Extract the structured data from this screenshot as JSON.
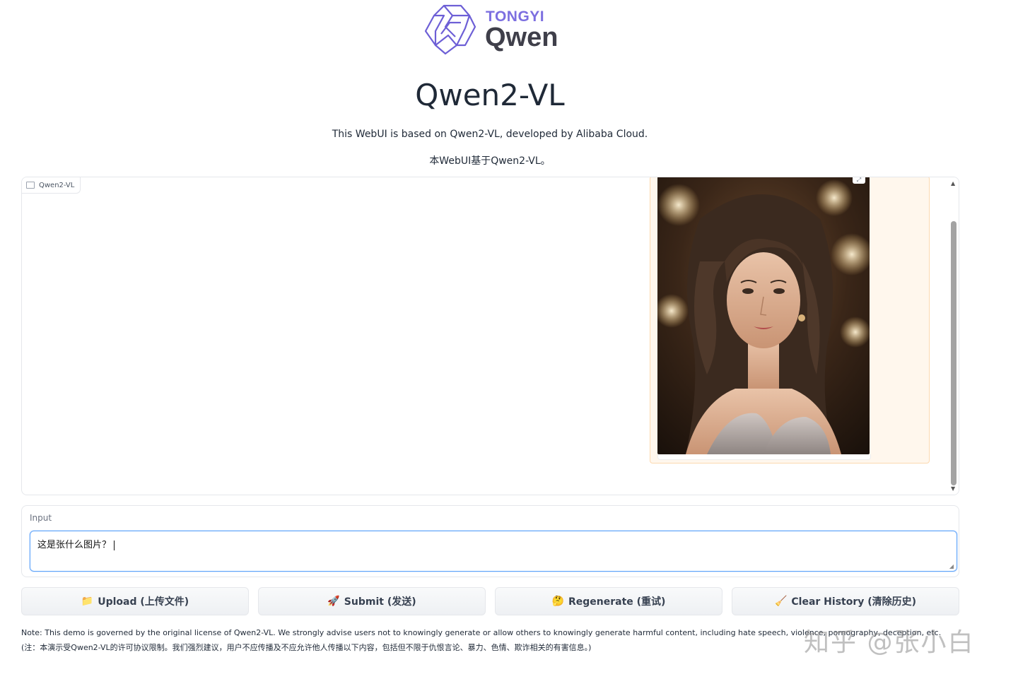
{
  "logo": {
    "brand_top": "TONGYI",
    "brand_main": "Qwen"
  },
  "header": {
    "title": "Qwen2-VL",
    "subtitle_en": "This WebUI is based on Qwen2-VL, developed by Alibaba Cloud.",
    "subtitle_zh": "本WebUI基于Qwen2-VL。"
  },
  "chat": {
    "label": "Qwen2-VL",
    "messages": [
      {
        "role": "user",
        "type": "image",
        "alt": "uploaded image"
      }
    ]
  },
  "input": {
    "label": "Input",
    "value": "这是张什么图片？"
  },
  "buttons": {
    "upload": {
      "emoji": "📁",
      "label": "Upload (上传文件)"
    },
    "submit": {
      "emoji": "🚀",
      "label": "Submit (发送)"
    },
    "regenerate": {
      "emoji": "🤔",
      "label": "Regenerate (重试)"
    },
    "clear": {
      "emoji": "🧹",
      "label": "Clear History (清除历史)"
    }
  },
  "note": "Note: This demo is governed by the original license of Qwen2-VL. We strongly advise users not to knowingly generate or allow others to knowingly generate harmful content, including hate speech, violence, pornography, deception, etc. (注：本演示受Qwen2-VL的许可协议限制。我们强烈建议，用户不应传播及不应允许他人传播以下内容，包括但不限于仇恨言论、暴力、色情、欺诈相关的有害信息。)",
  "watermark": "知乎 @张小白",
  "colors": {
    "accent": "#7c6fe0",
    "user_bubble": "#fff7ed",
    "focus_border": "#60a5fa"
  }
}
